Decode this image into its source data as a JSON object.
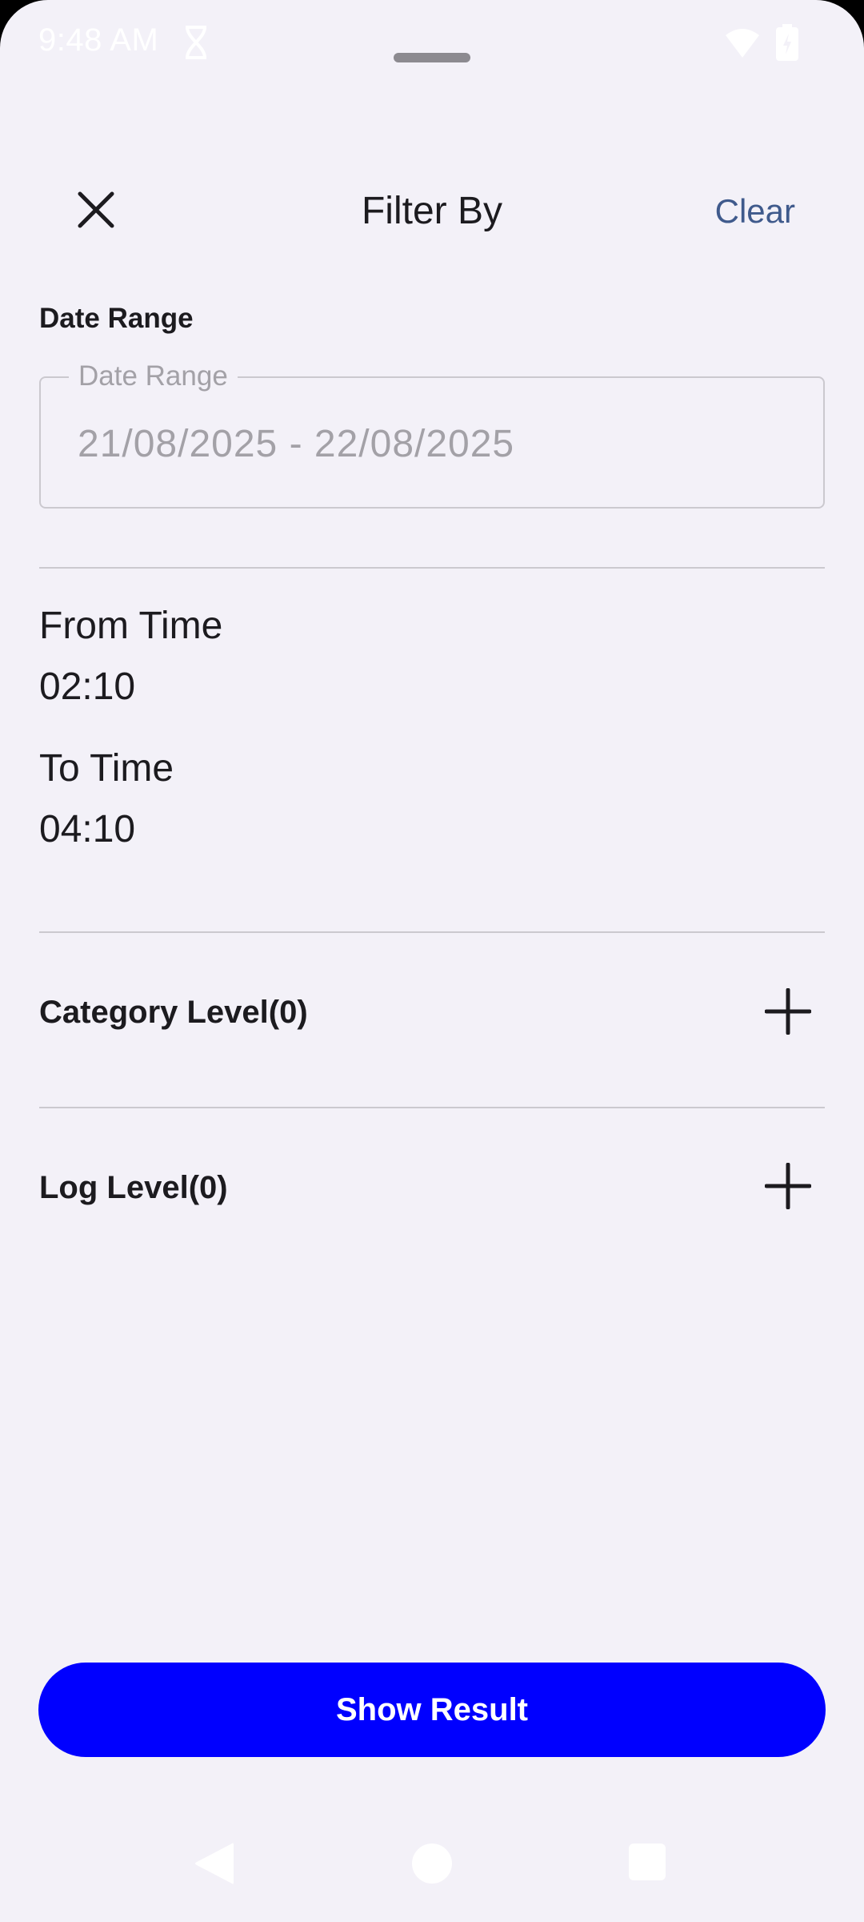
{
  "status_bar": {
    "time": "9:48 AM",
    "icons": [
      "dna-icon",
      "wifi-icon",
      "battery-icon"
    ]
  },
  "header": {
    "title": "Filter By",
    "close_icon": "close-icon",
    "clear_label": "Clear"
  },
  "date_range": {
    "section_label": "Date Range",
    "field_label": "Date Range",
    "value": "21/08/2025 - 22/08/2025"
  },
  "time": {
    "from_label": "From Time",
    "from_value": "02:10",
    "to_label": "To Time",
    "to_value": "04:10"
  },
  "filters": [
    {
      "label": "Category Level(0)",
      "icon": "plus-icon"
    },
    {
      "label": "Log Level(0)",
      "icon": "plus-icon"
    }
  ],
  "action": {
    "show_result_label": "Show Result"
  },
  "nav_bar": {
    "icons": [
      "back-icon",
      "home-icon",
      "recents-icon"
    ]
  },
  "colors": {
    "background": "#f3f1f8",
    "accent_button": "#0000ff",
    "link": "#3f5a8c",
    "divider": "#cbc9cf",
    "hint_text": "#a3a1a7"
  }
}
